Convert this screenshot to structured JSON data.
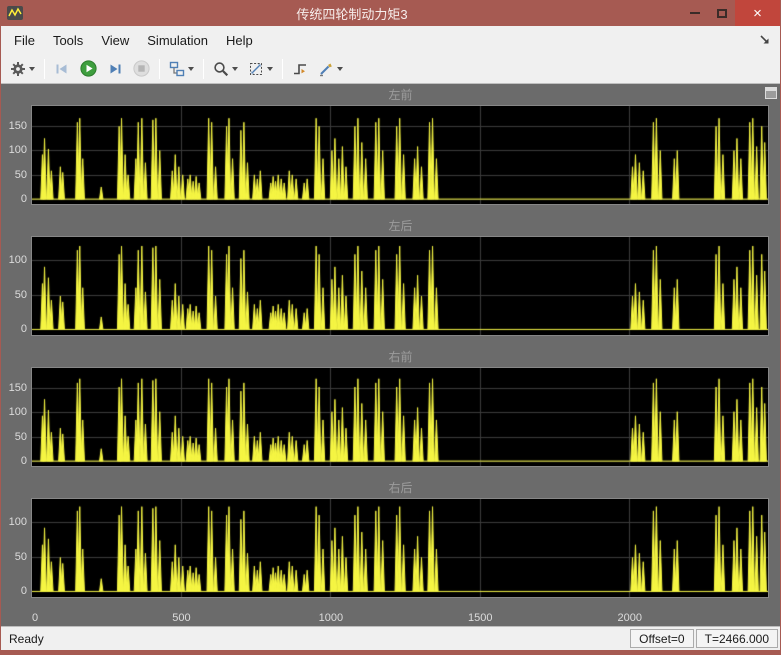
{
  "window": {
    "title": "传统四轮制动力矩3"
  },
  "menu": {
    "items": [
      {
        "label": "File"
      },
      {
        "label": "Tools"
      },
      {
        "label": "View"
      },
      {
        "label": "Simulation"
      },
      {
        "label": "Help"
      }
    ]
  },
  "toolbar": {
    "buttons": [
      "settings",
      "step-back",
      "run",
      "step-forward",
      "stop",
      "highlight-block",
      "zoom",
      "fit-to-view",
      "trigger",
      "measurements"
    ]
  },
  "status": {
    "ready": "Ready",
    "offset": "Offset=0",
    "time": "T=2466.000"
  },
  "colors": {
    "titlebar": "#a65a52",
    "close_button": "#c1463c",
    "scope_background": "#6b6b6b",
    "plot_background": "#000000",
    "signal": "#f5f542",
    "grid": "#3c3c3c"
  },
  "chart_data": {
    "type": "line",
    "xlim": [
      0,
      2466
    ],
    "xticks": [
      0,
      500,
      1000,
      1500,
      2000
    ],
    "bg": "#000000",
    "grid_color": "#3c3c3c",
    "signal_color": "#f5f542",
    "plots": [
      {
        "title": "左前",
        "peak": 165,
        "ylim": [
          -10,
          190
        ],
        "yticks": [
          0,
          50,
          100,
          150
        ]
      },
      {
        "title": "左后",
        "peak": 120,
        "ylim": [
          -8,
          133
        ],
        "yticks": [
          0,
          50,
          100
        ]
      },
      {
        "title": "右前",
        "peak": 168,
        "ylim": [
          -10,
          190
        ],
        "yticks": [
          0,
          50,
          100,
          150
        ]
      },
      {
        "title": "右后",
        "peak": 122,
        "ylim": [
          -8,
          133
        ],
        "yticks": [
          0,
          50,
          100
        ]
      }
    ],
    "events": [
      [
        35,
        0.55
      ],
      [
        42,
        0.75
      ],
      [
        55,
        0.62
      ],
      [
        65,
        0.35
      ],
      [
        95,
        0.4
      ],
      [
        103,
        0.33
      ],
      [
        152,
        0.95
      ],
      [
        160,
        1.0
      ],
      [
        170,
        0.5
      ],
      [
        232,
        0.15
      ],
      [
        292,
        0.9
      ],
      [
        300,
        1.0
      ],
      [
        312,
        0.55
      ],
      [
        322,
        0.3
      ],
      [
        348,
        0.5
      ],
      [
        356,
        0.95
      ],
      [
        368,
        1.0
      ],
      [
        380,
        0.45
      ],
      [
        405,
        0.98
      ],
      [
        415,
        1.0
      ],
      [
        428,
        0.6
      ],
      [
        470,
        0.35
      ],
      [
        480,
        0.55
      ],
      [
        492,
        0.4
      ],
      [
        505,
        0.3
      ],
      [
        522,
        0.25
      ],
      [
        530,
        0.3
      ],
      [
        540,
        0.22
      ],
      [
        550,
        0.28
      ],
      [
        560,
        0.2
      ],
      [
        592,
        1.0
      ],
      [
        602,
        0.95
      ],
      [
        615,
        0.4
      ],
      [
        652,
        0.9
      ],
      [
        660,
        1.0
      ],
      [
        672,
        0.5
      ],
      [
        700,
        0.85
      ],
      [
        710,
        0.95
      ],
      [
        722,
        0.45
      ],
      [
        745,
        0.3
      ],
      [
        755,
        0.25
      ],
      [
        765,
        0.35
      ],
      [
        800,
        0.2
      ],
      [
        808,
        0.28
      ],
      [
        816,
        0.22
      ],
      [
        825,
        0.3
      ],
      [
        835,
        0.25
      ],
      [
        845,
        0.2
      ],
      [
        862,
        0.35
      ],
      [
        872,
        0.3
      ],
      [
        885,
        0.25
      ],
      [
        912,
        0.2
      ],
      [
        922,
        0.25
      ],
      [
        952,
        1.0
      ],
      [
        962,
        0.9
      ],
      [
        975,
        0.5
      ],
      [
        1005,
        0.6
      ],
      [
        1015,
        0.75
      ],
      [
        1028,
        0.5
      ],
      [
        1040,
        0.65
      ],
      [
        1052,
        0.4
      ],
      [
        1082,
        0.9
      ],
      [
        1092,
        1.0
      ],
      [
        1105,
        0.7
      ],
      [
        1118,
        0.5
      ],
      [
        1152,
        0.95
      ],
      [
        1162,
        1.0
      ],
      [
        1175,
        0.6
      ],
      [
        1222,
        0.9
      ],
      [
        1232,
        1.0
      ],
      [
        1245,
        0.55
      ],
      [
        1282,
        0.5
      ],
      [
        1292,
        0.65
      ],
      [
        1305,
        0.4
      ],
      [
        1332,
        0.95
      ],
      [
        1342,
        1.0
      ],
      [
        1355,
        0.5
      ],
      [
        2012,
        0.4
      ],
      [
        2022,
        0.55
      ],
      [
        2035,
        0.45
      ],
      [
        2048,
        0.35
      ],
      [
        2082,
        0.95
      ],
      [
        2092,
        1.0
      ],
      [
        2105,
        0.6
      ],
      [
        2152,
        0.5
      ],
      [
        2162,
        0.6
      ],
      [
        2292,
        0.9
      ],
      [
        2302,
        1.0
      ],
      [
        2315,
        0.55
      ],
      [
        2352,
        0.6
      ],
      [
        2362,
        0.75
      ],
      [
        2375,
        0.5
      ],
      [
        2405,
        0.95
      ],
      [
        2415,
        1.0
      ],
      [
        2428,
        0.65
      ],
      [
        2445,
        0.9
      ],
      [
        2455,
        0.7
      ]
    ]
  }
}
